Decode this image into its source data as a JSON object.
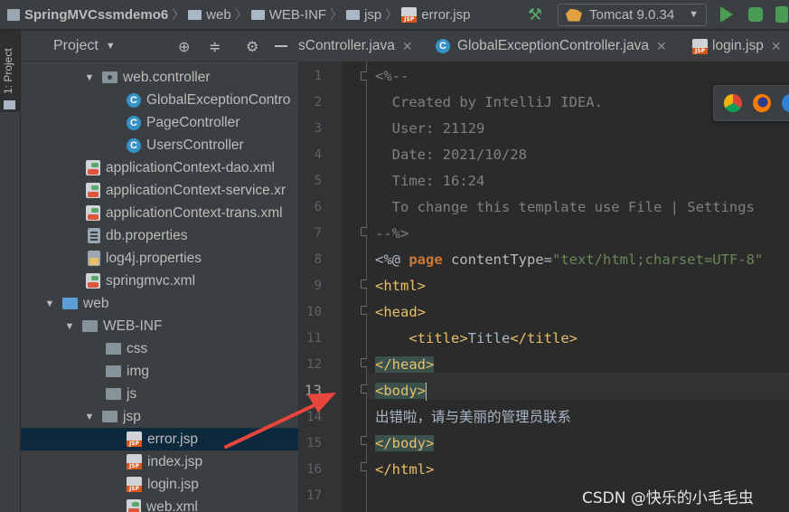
{
  "navbar": {
    "crumbs": [
      "SpringMVCssmdemo6",
      "web",
      "WEB-INF",
      "jsp",
      "error.jsp"
    ],
    "run_config": "Tomcat 9.0.34"
  },
  "left_stripe": {
    "label": "1: Project"
  },
  "project_panel": {
    "title": "Project",
    "tree": [
      {
        "label": "web.controller",
        "icon": "package-folder-icon",
        "caret": "expanded"
      },
      {
        "label": "GlobalExceptionContro",
        "icon": "class-icon"
      },
      {
        "label": "PageController",
        "icon": "class-icon"
      },
      {
        "label": "UsersController",
        "icon": "class-icon"
      },
      {
        "label": "applicationContext-dao.xml",
        "icon": "spring-xml-icon"
      },
      {
        "label": "applicationContext-service.xr",
        "icon": "spring-xml-icon"
      },
      {
        "label": "applicationContext-trans.xml",
        "icon": "spring-xml-icon"
      },
      {
        "label": "db.properties",
        "icon": "properties-file-icon"
      },
      {
        "label": "log4j.properties",
        "icon": "properties-file-icon"
      },
      {
        "label": "springmvc.xml",
        "icon": "spring-xml-icon"
      },
      {
        "label": "web",
        "icon": "web-folder-icon",
        "caret": "expanded"
      },
      {
        "label": "WEB-INF",
        "icon": "folder-icon",
        "caret": "expanded"
      },
      {
        "label": "css",
        "icon": "folder-icon"
      },
      {
        "label": "img",
        "icon": "folder-icon"
      },
      {
        "label": "js",
        "icon": "folder-icon"
      },
      {
        "label": "jsp",
        "icon": "folder-icon",
        "caret": "expanded"
      },
      {
        "label": "error.jsp",
        "icon": "jsp-file-icon",
        "selected": true
      },
      {
        "label": "index.jsp",
        "icon": "jsp-file-icon"
      },
      {
        "label": "login.jsp",
        "icon": "jsp-file-icon"
      },
      {
        "label": "web.xml",
        "icon": "spring-xml-icon"
      }
    ]
  },
  "editor_tabs": [
    {
      "label": "sController.java",
      "icon": "class-icon"
    },
    {
      "label": "GlobalExceptionController.java",
      "icon": "class-icon"
    },
    {
      "label": "login.jsp",
      "icon": "jsp-file-icon"
    }
  ],
  "editor": {
    "line_numbers": [
      "1",
      "2",
      "3",
      "4",
      "5",
      "6",
      "7",
      "8",
      "9",
      "10",
      "11",
      "12",
      "13",
      "14",
      "15",
      "16",
      "17"
    ],
    "current_line": "13",
    "code": {
      "l1": "<%--",
      "l2": "  Created by IntelliJ IDEA.",
      "l3": "  User: 21129",
      "l4": "  Date: 2021/10/28",
      "l5": "  Time: 16:24",
      "l6": "  To change this template use File | Settings",
      "l7": "--%>",
      "l8_a": "<%@ ",
      "l8_b": "page ",
      "l8_c": "contentType",
      "l8_d": "=",
      "l8_e": "\"text/html;charset=UTF-8\"",
      "l9": "<html>",
      "l10": "<head>",
      "l11_a": "    <title>",
      "l11_b": "Title",
      "l11_c": "</title>",
      "l12": "</head>",
      "l13": "<body>",
      "l14": "出错啦，请与美丽的管理员联系",
      "l15": "</body>",
      "l16": "</html>"
    }
  },
  "watermark": "CSDN @快乐的小毛毛虫",
  "colors": {
    "background": "#2b2b2b",
    "panel": "#3c3f41",
    "selection": "#0d293e",
    "tag": "#e8bf6a",
    "keyword": "#cc7832",
    "string": "#6a8759",
    "comment": "#808080",
    "arrow": "#e8453c"
  }
}
